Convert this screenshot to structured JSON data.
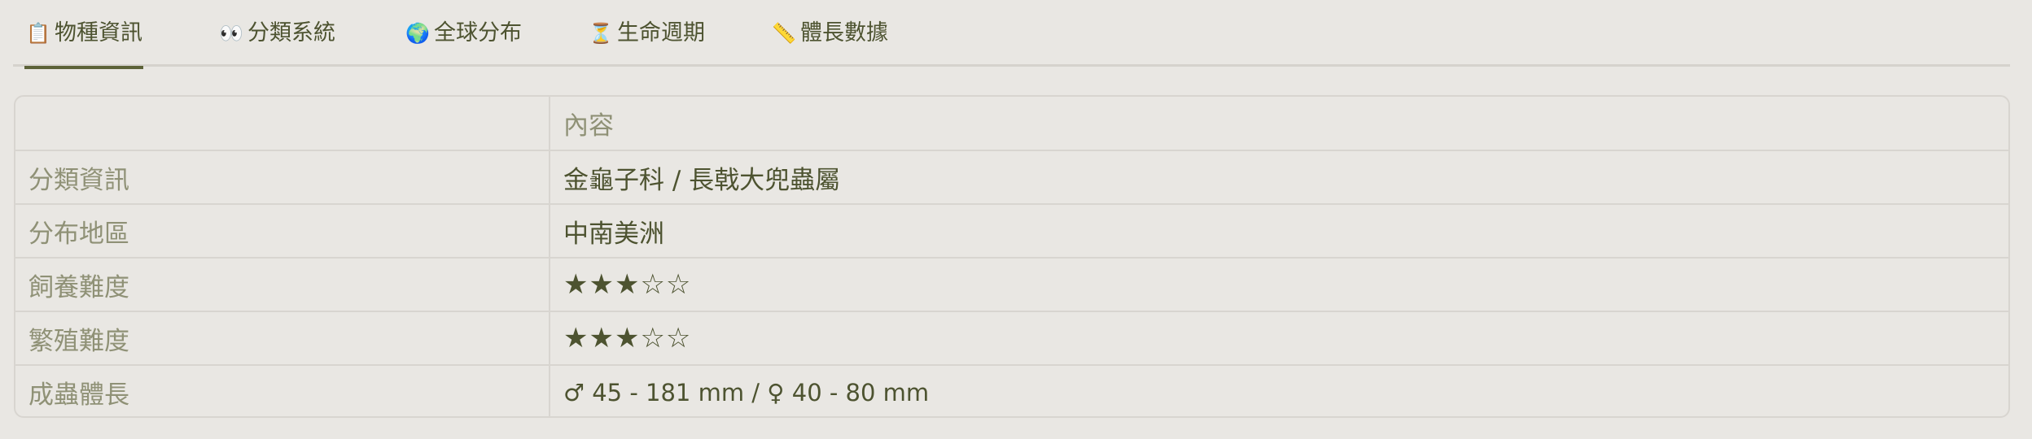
{
  "tabs": [
    {
      "icon": "clipboard-icon",
      "icon_glyph": "📋",
      "label": "物種資訊",
      "active": true
    },
    {
      "icon": "eyes-icon",
      "icon_glyph": "👀",
      "label": "分類系統",
      "active": false
    },
    {
      "icon": "globe-icon",
      "icon_glyph": "🌍",
      "label": "全球分布",
      "active": false
    },
    {
      "icon": "hourglass-icon",
      "icon_glyph": "⏳",
      "label": "生命週期",
      "active": false
    },
    {
      "icon": "ruler-icon",
      "icon_glyph": "📏",
      "label": "體長數據",
      "active": false
    }
  ],
  "table": {
    "header": {
      "col1": "",
      "col2": "內容"
    },
    "rows": [
      {
        "label": "分類資訊",
        "value": "金龜子科 / 長戟大兜蟲屬"
      },
      {
        "label": "分布地區",
        "value": "中南美洲"
      },
      {
        "label": "飼養難度",
        "value": "★★★☆☆",
        "rating": 3,
        "max": 5
      },
      {
        "label": "繁殖難度",
        "value": "★★★☆☆",
        "rating": 3,
        "max": 5
      },
      {
        "label": "成蟲體長",
        "value": "♂ 45 - 181 mm / ♀ 40 - 80 mm"
      }
    ]
  },
  "colors": {
    "accent": "#5c6238",
    "text": "#4d5330",
    "muted": "#8f9176",
    "background": "#e9e7e3",
    "border": "#d8d5d0"
  }
}
